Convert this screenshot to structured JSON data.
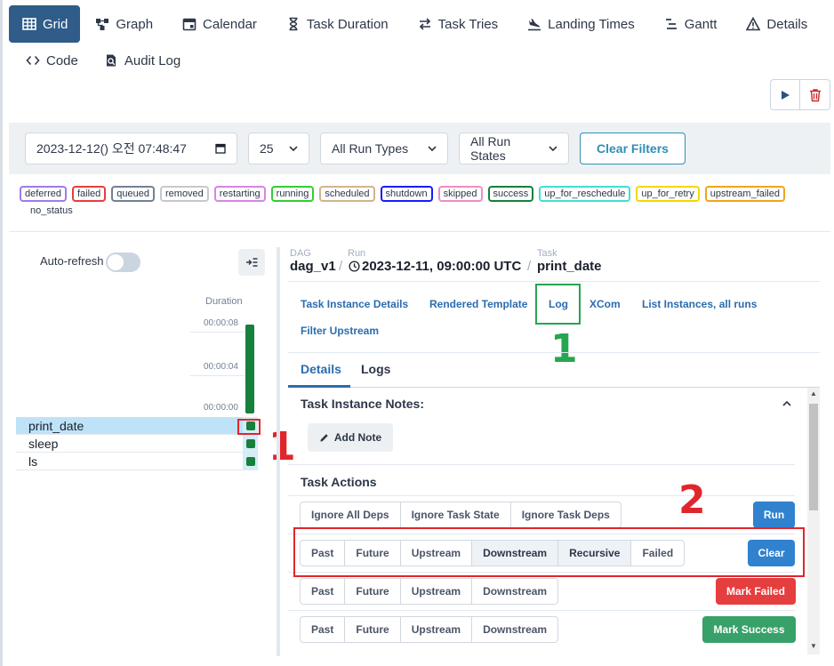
{
  "nav": {
    "tabs_row1": [
      {
        "label": "Grid",
        "icon": "grid-icon",
        "active": true
      },
      {
        "label": "Graph",
        "icon": "graph-icon"
      },
      {
        "label": "Calendar",
        "icon": "calendar-icon"
      },
      {
        "label": "Task Duration",
        "icon": "hourglass-icon"
      },
      {
        "label": "Task Tries",
        "icon": "arrows-icon"
      },
      {
        "label": "Landing Times",
        "icon": "plane-landing-icon"
      },
      {
        "label": "Gantt",
        "icon": "gantt-icon"
      },
      {
        "label": "Details",
        "icon": "warning-triangle-icon"
      }
    ],
    "tabs_row2": [
      {
        "label": "Code",
        "icon": "code-icon"
      },
      {
        "label": "Audit Log",
        "icon": "audit-log-icon"
      }
    ]
  },
  "filters": {
    "date_value": "2023-12-12() 오전 07:48:47",
    "num_runs": "25",
    "run_types": "All Run Types",
    "run_states": "All Run States",
    "clear_label": "Clear Filters"
  },
  "legend": [
    {
      "label": "deferred",
      "color": "#9f7aea"
    },
    {
      "label": "failed",
      "color": "#e53e3e"
    },
    {
      "label": "queued",
      "color": "#718096"
    },
    {
      "label": "removed",
      "color": "#c8c8c8"
    },
    {
      "label": "restarting",
      "color": "#d784e5"
    },
    {
      "label": "running",
      "color": "#32cd32"
    },
    {
      "label": "scheduled",
      "color": "#d2b48c"
    },
    {
      "label": "shutdown",
      "color": "#1a1aff"
    },
    {
      "label": "skipped",
      "color": "#f08cc4"
    },
    {
      "label": "success",
      "color": "#16803c"
    },
    {
      "label": "up_for_reschedule",
      "color": "#40e0d0"
    },
    {
      "label": "up_for_retry",
      "color": "#f5d800"
    },
    {
      "label": "upstream_failed",
      "color": "#f2a31c"
    }
  ],
  "legend_extra": "no_status",
  "grid": {
    "auto_refresh_label": "Auto-refresh",
    "duration_label": "Duration",
    "ticks": [
      "00:00:08",
      "00:00:04",
      "00:00:00"
    ],
    "tasks": [
      "print_date",
      "sleep",
      "ls"
    ]
  },
  "breadcrumb": {
    "dag_label": "DAG",
    "dag_value": "dag_v1",
    "run_label": "Run",
    "run_value": "2023-12-11, 09:00:00 UTC",
    "task_label": "Task",
    "task_value": "print_date"
  },
  "subtabs": [
    "Task Instance Details",
    "Rendered Template",
    "Log",
    "XCom",
    "List Instances, all runs",
    "Filter Upstream"
  ],
  "detail_tabs": [
    "Details",
    "Logs"
  ],
  "notes_title": "Task Instance Notes:",
  "add_note_label": "Add Note",
  "actions_title": "Task Actions",
  "run_row": {
    "options": [
      "Ignore All Deps",
      "Ignore Task State",
      "Ignore Task Deps"
    ],
    "button": "Run"
  },
  "clear_row": {
    "options": [
      "Past",
      "Future",
      "Upstream",
      "Downstream",
      "Recursive",
      "Failed"
    ],
    "button": "Clear"
  },
  "failed_row": {
    "options": [
      "Past",
      "Future",
      "Upstream",
      "Downstream"
    ],
    "button": "Mark Failed"
  },
  "success_row": {
    "options": [
      "Past",
      "Future",
      "Upstream",
      "Downstream"
    ],
    "button": "Mark Success"
  },
  "annotations": {
    "one": "1",
    "two": "2"
  },
  "colors": {
    "accent": "#2f5c89",
    "run_btn": "#3182ce",
    "clear_btn": "#3182ce",
    "failed_btn": "#e53e3e",
    "success_btn": "#38a169",
    "success_bar": "#16803c"
  }
}
